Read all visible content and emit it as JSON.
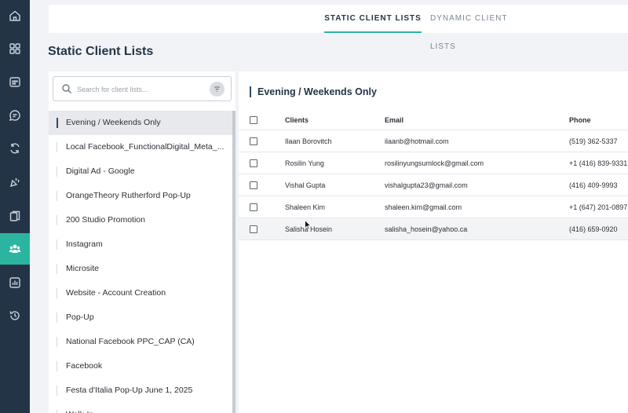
{
  "nav": {
    "items": [
      {
        "icon": "home-icon"
      },
      {
        "icon": "dashboard-grid-icon"
      },
      {
        "icon": "calendar-icon"
      },
      {
        "icon": "chat-icon"
      },
      {
        "icon": "sync-icon"
      },
      {
        "icon": "campaign-icon"
      },
      {
        "icon": "documents-icon"
      },
      {
        "icon": "clients-group-icon",
        "active": true
      },
      {
        "icon": "reports-chart-icon"
      },
      {
        "icon": "history-icon"
      }
    ],
    "accent_color": "#2bb5a0",
    "background_color": "#243447"
  },
  "tabs": {
    "static_label": "STATIC CLIENT LISTS",
    "dynamic_label": "DYNAMIC CLIENT LISTS",
    "active": "STATIC CLIENT LISTS"
  },
  "page_title": "Static Client Lists",
  "search": {
    "placeholder": "Search for client lists...",
    "value": ""
  },
  "client_lists": [
    "Evening / Weekends Only",
    "Local Facebook_FunctionalDigital_Meta_...",
    "Digital Ad - Google",
    "OrangeTheory Rutherford Pop-Up",
    "200 Studio Promotion",
    "Instagram",
    "Microsite",
    "Website - Account Creation",
    "Pop-Up",
    "National Facebook PPC_CAP (CA)",
    "Facebook",
    "Festa d'Italia Pop-Up June 1, 2025",
    "Walk-In"
  ],
  "selected_list": "Evening / Weekends Only",
  "detail": {
    "title": "Evening / Weekends Only",
    "columns": {
      "clients": "Clients",
      "email": "Email",
      "phone": "Phone"
    },
    "rows": [
      {
        "name": "Ilaan Borovitch",
        "email": "ilaanb@hotmail.com",
        "phone": "(519) 362-5337"
      },
      {
        "name": "Rosilin Yung",
        "email": "rosilinyungsumlock@gmail.com",
        "phone": "+1 (416) 839-9331"
      },
      {
        "name": "Vishal Gupta",
        "email": "vishalgupta23@gmail.com",
        "phone": "(416) 409-9993"
      },
      {
        "name": "Shaleen Kim",
        "email": "shaleen.kim@gmail.com",
        "phone": "+1 (647) 201-0897"
      },
      {
        "name": "Salisha Hosein",
        "email": "salisha_hosein@yahoo.ca",
        "phone": "(416) 659-0920"
      }
    ]
  }
}
